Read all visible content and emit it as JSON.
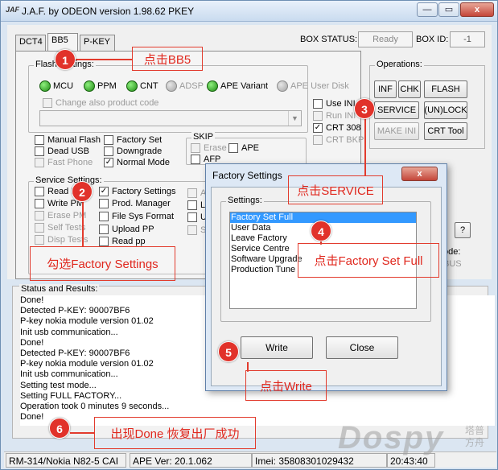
{
  "window": {
    "title": "J.A.F. by ODEON version 1.98.62 PKEY",
    "icon": "JAF"
  },
  "tabs": [
    {
      "label": "DCT4"
    },
    {
      "label": "BB5"
    },
    {
      "label": "P-KEY"
    }
  ],
  "box_status": {
    "label": "BOX STATUS:",
    "value": "Ready",
    "id_label": "BOX ID:",
    "id_value": "-1"
  },
  "flash": {
    "group_label": "Flash Settings:",
    "leds": [
      {
        "label": "MCU"
      },
      {
        "label": "PPM"
      },
      {
        "label": "CNT"
      },
      {
        "label": "ADSP"
      },
      {
        "label": "APE Variant"
      },
      {
        "label": "APE User Disk"
      }
    ],
    "change_product_code": "Change also product code",
    "options": [
      {
        "label": "Manual Flash"
      },
      {
        "label": "Factory Set"
      },
      {
        "label": "Dead USB"
      },
      {
        "label": "Downgrade"
      },
      {
        "label": "Fast Phone"
      },
      {
        "label": "Normal Mode",
        "check": "✓"
      }
    ]
  },
  "skip": {
    "label": "SKIP",
    "items": [
      {
        "label": "Erase"
      },
      {
        "label": "APE"
      },
      {
        "label": "AFP"
      }
    ]
  },
  "right_checks": [
    {
      "label": "Use INI"
    },
    {
      "label": "Run INI"
    },
    {
      "label": "CRT 308",
      "check": "✓"
    },
    {
      "label": "CRT BKP"
    }
  ],
  "operations": {
    "label": "Operations:",
    "buttons": [
      {
        "label": "INF"
      },
      {
        "label": "CHK"
      },
      {
        "label": "FLASH"
      },
      {
        "label": "SERVICE"
      },
      {
        "label": "(UN)LOCK"
      },
      {
        "label": "MAKE INI"
      },
      {
        "label": "CRT Tool"
      }
    ]
  },
  "side": {
    "q_btn": "?",
    "mode_label": "ode:",
    "bus": "BUS"
  },
  "service": {
    "label": "Service Settings:",
    "col1": [
      {
        "label": "Read PP"
      },
      {
        "label": "Write PM"
      },
      {
        "label": "Erase PM"
      },
      {
        "label": "Self Tests"
      },
      {
        "label": "Disp Tests"
      }
    ],
    "col2": [
      {
        "label": "Factory Settings",
        "check": "✓"
      },
      {
        "label": "Prod. Manager"
      },
      {
        "label": "File Sys Format"
      },
      {
        "label": "Upload PP"
      },
      {
        "label": "Read pp"
      }
    ],
    "col3": [
      {
        "label": "Al"
      },
      {
        "label": "Lif"
      },
      {
        "label": "Us"
      },
      {
        "label": "Sx"
      }
    ]
  },
  "status": {
    "label": "Status and Results:",
    "lines": [
      "Done!",
      "Detected P-KEY: 90007BF6",
      "P-key nokia module version 01.02",
      "Init usb communication...",
      "Done!",
      "Detected P-KEY: 90007BF6",
      "P-key nokia module version 01.02",
      "Init usb communication...",
      "Setting test mode...",
      "Setting FULL FACTORY...",
      "Operation took 0 minutes 9 seconds...",
      "Done!"
    ]
  },
  "statusbar": {
    "phone": "RM-314/Nokia N82-5 CAI",
    "ape": "APE Ver: 20.1.062",
    "imei": "Imei: 35808301029432",
    "time": "20:43:40"
  },
  "dialog": {
    "title": "Factory Settings",
    "close": "x",
    "settings_label": "Settings:",
    "items": [
      {
        "label": "Factory Set Full",
        "selected": true
      },
      {
        "label": "User Data"
      },
      {
        "label": "Leave Factory"
      },
      {
        "label": "Service Centre"
      },
      {
        "label": "Software Upgrade"
      },
      {
        "label": "Production Tune"
      }
    ],
    "write_btn": "Write",
    "close_btn": "Close"
  },
  "annotations": [
    {
      "n": "1",
      "text": "点击BB5"
    },
    {
      "n": "2",
      "text": "勾选Factory Settings"
    },
    {
      "n": "3",
      "text": "点击SERVICE"
    },
    {
      "n": "4",
      "text": "点击Factory Set Full"
    },
    {
      "n": "5",
      "text": "点击Write"
    },
    {
      "n": "6",
      "text": "出现Done 恢复出厂成功"
    }
  ],
  "watermark": {
    "main": "Dospy",
    "side1": "塔普",
    "side2": "方舟"
  },
  "colors": {
    "accent": "#e1322a",
    "selection": "#3399ff",
    "led_on": "#1f8a14"
  }
}
